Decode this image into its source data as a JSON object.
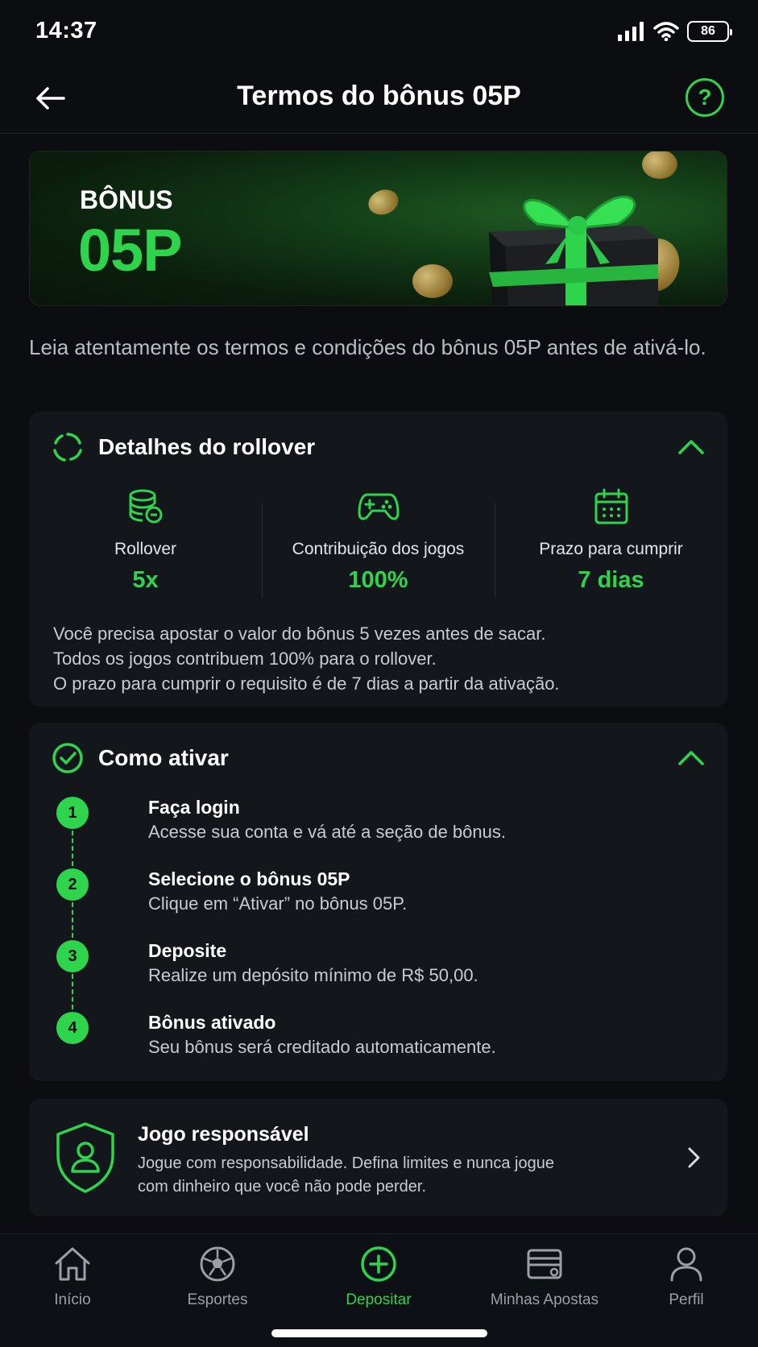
{
  "status": {
    "time": "14:37",
    "battery": "86"
  },
  "header": {
    "title": "Termos do bônus 05P",
    "help": "?"
  },
  "banner": {
    "label": "BÔNUS",
    "code": "05P"
  },
  "intro": "Leia atentamente os termos e condições do bônus 05P antes de ativá-lo.",
  "rollover": {
    "title": "Detalhes do rollover",
    "stats": [
      {
        "label": "Rollover",
        "value": "5x",
        "icon": "coins-icon"
      },
      {
        "label": "Contribuição dos jogos",
        "value": "100%",
        "icon": "gamepad-icon"
      },
      {
        "label": "Prazo para cumprir",
        "value": "7 dias",
        "icon": "calendar-icon"
      }
    ],
    "desc": [
      "Você precisa apostar o valor do bônus 5 vezes antes de sacar.",
      "Todos os jogos contribuem 100% para o rollover.",
      "O prazo para cumprir o requisito é de 7 dias a partir da ativação."
    ]
  },
  "activate": {
    "title": "Como ativar",
    "steps": [
      {
        "num": "1",
        "title": "Faça login",
        "desc": "Acesse sua conta e vá até a seção de bônus."
      },
      {
        "num": "2",
        "title": "Selecione o bônus 05P",
        "desc": "Clique em “Ativar” no bônus 05P."
      },
      {
        "num": "3",
        "title": "Deposite",
        "desc": "Realize um depósito mínimo de R$ 50,00."
      },
      {
        "num": "4",
        "title": "Bônus ativado",
        "desc": "Seu bônus será creditado automaticamente."
      }
    ]
  },
  "responsible": {
    "title": "Jogo responsável",
    "desc": "Jogue com responsabilidade. Defina limites e nunca jogue com dinheiro que você não pode perder."
  },
  "tabs": [
    {
      "label": "Início",
      "icon": "home-icon"
    },
    {
      "label": "Esportes",
      "icon": "soccer-ball-icon"
    },
    {
      "label": "Depositar",
      "icon": "plus-circle-icon",
      "active": true
    },
    {
      "label": "Minhas Apostas",
      "icon": "ticket-icon"
    },
    {
      "label": "Perfil",
      "icon": "user-icon"
    }
  ],
  "colors": {
    "accent": "#2fd44d",
    "background": "#0b0d10",
    "card": "#13171c"
  }
}
